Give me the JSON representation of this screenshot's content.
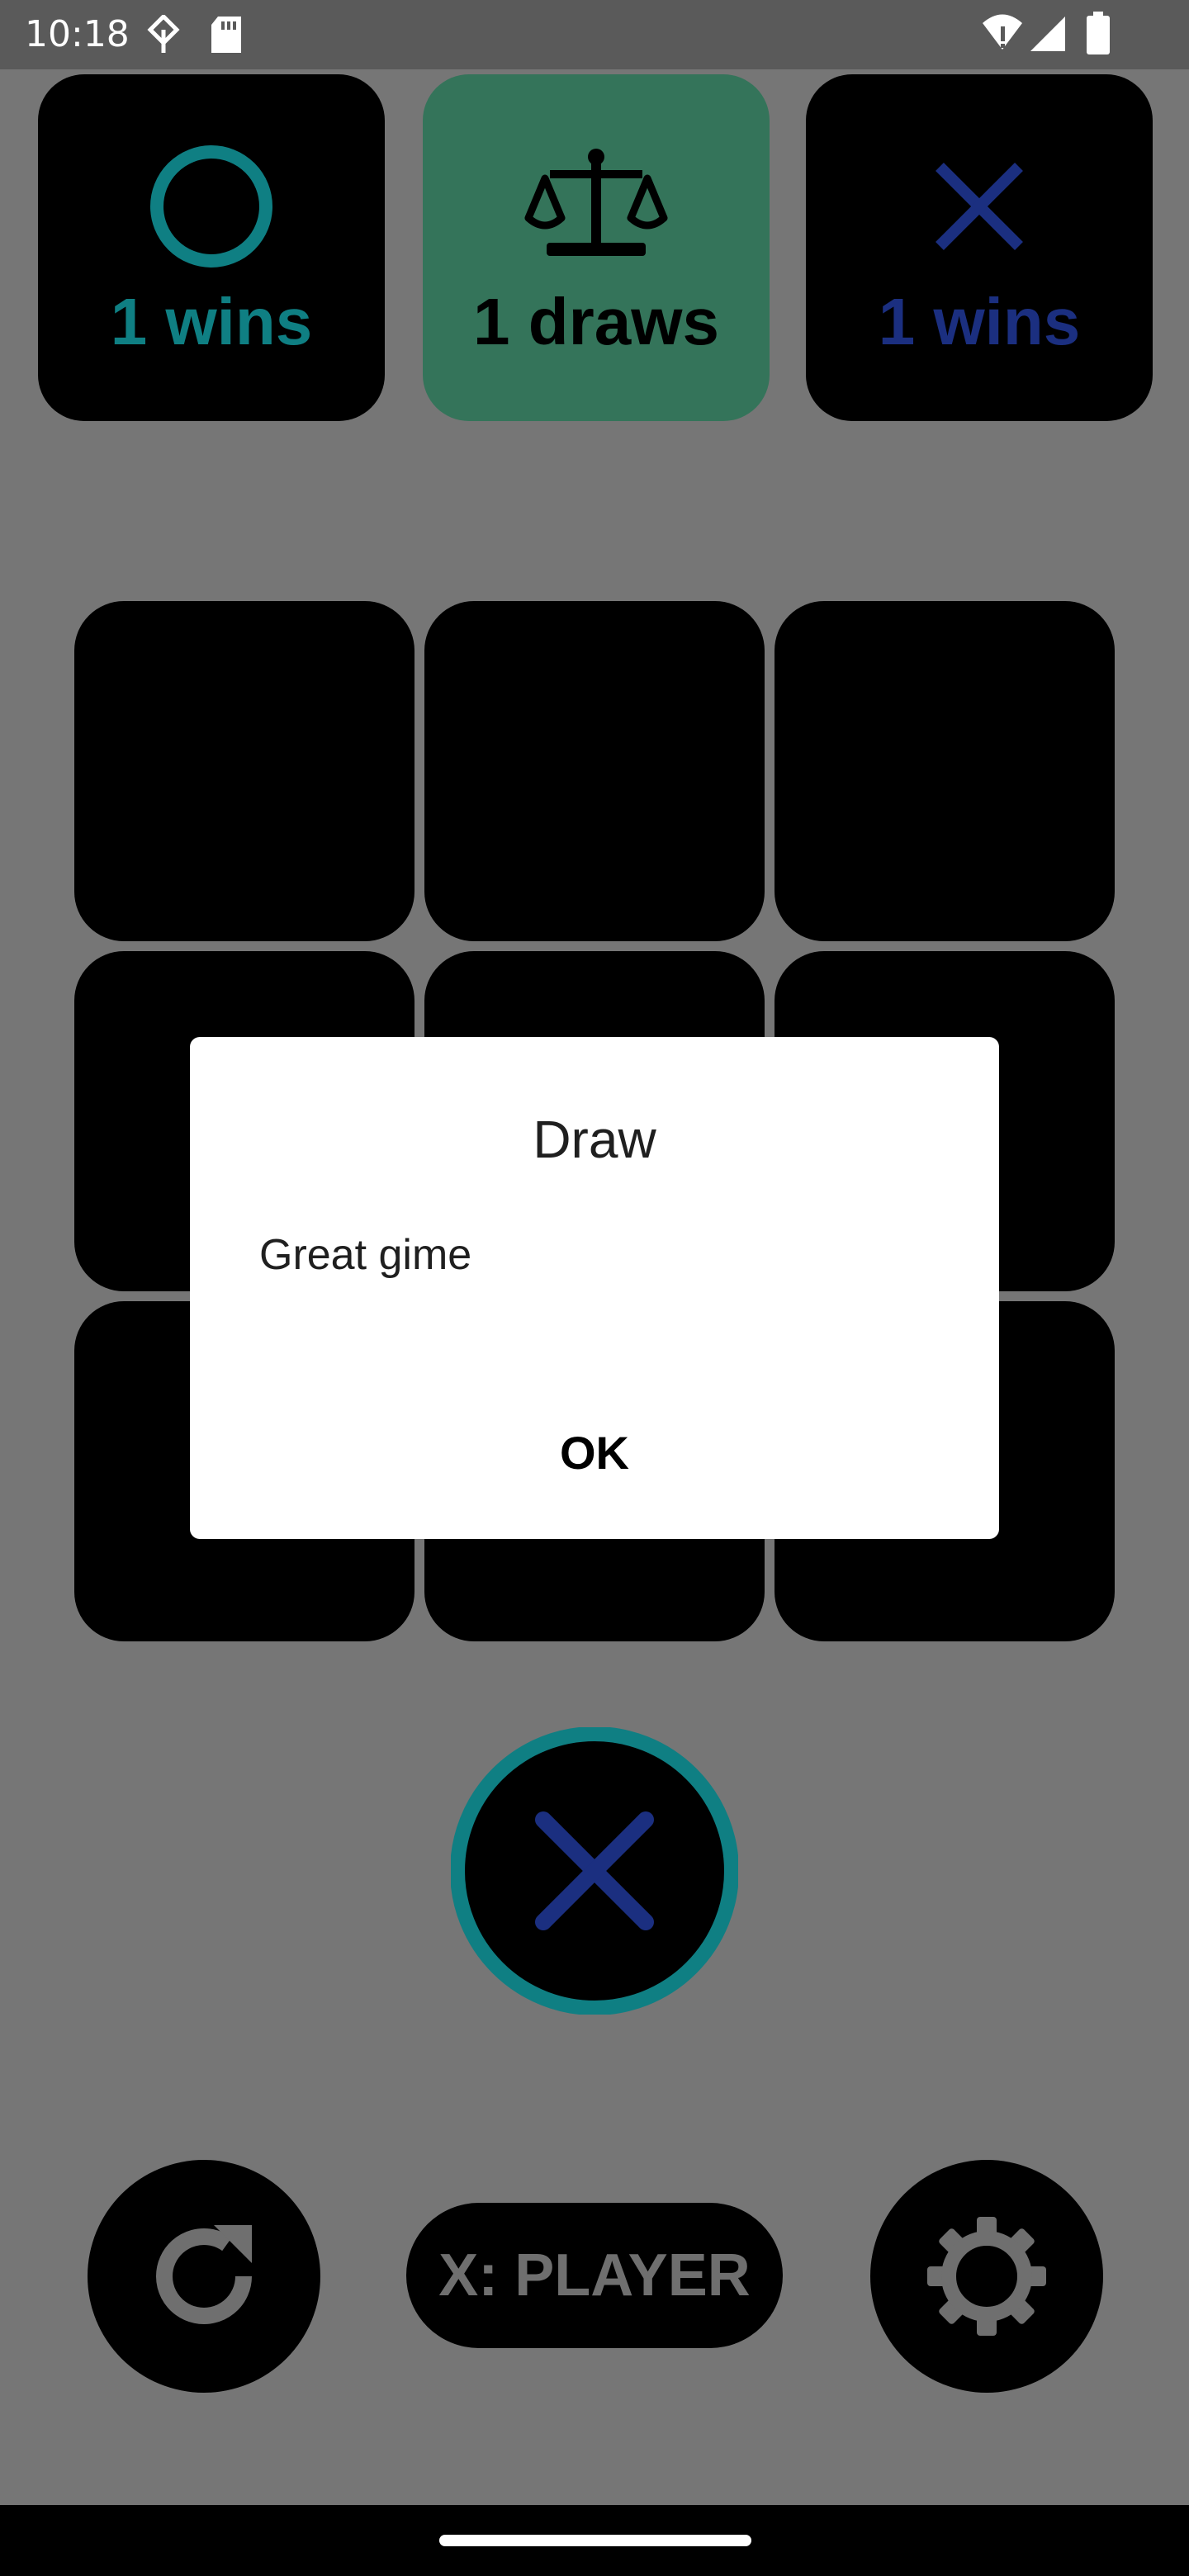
{
  "status_bar": {
    "time": "10:18"
  },
  "scoreboard": {
    "o_wins": "1 wins",
    "draws": "1 draws",
    "x_wins": "1 wins"
  },
  "dialog": {
    "title": "Draw",
    "message": "Great gime",
    "ok": "OK"
  },
  "controls": {
    "mode": "X: PLAYER"
  },
  "colors": {
    "teal": "#0f7f83",
    "navy": "#1b2f80",
    "draw_green": "#34745a",
    "dim_gray": "#6f6f6f"
  },
  "icons": {
    "o_mark": "o-icon",
    "draw": "scales-icon",
    "x_mark": "x-icon",
    "restart": "refresh-icon",
    "settings": "gear-icon"
  }
}
